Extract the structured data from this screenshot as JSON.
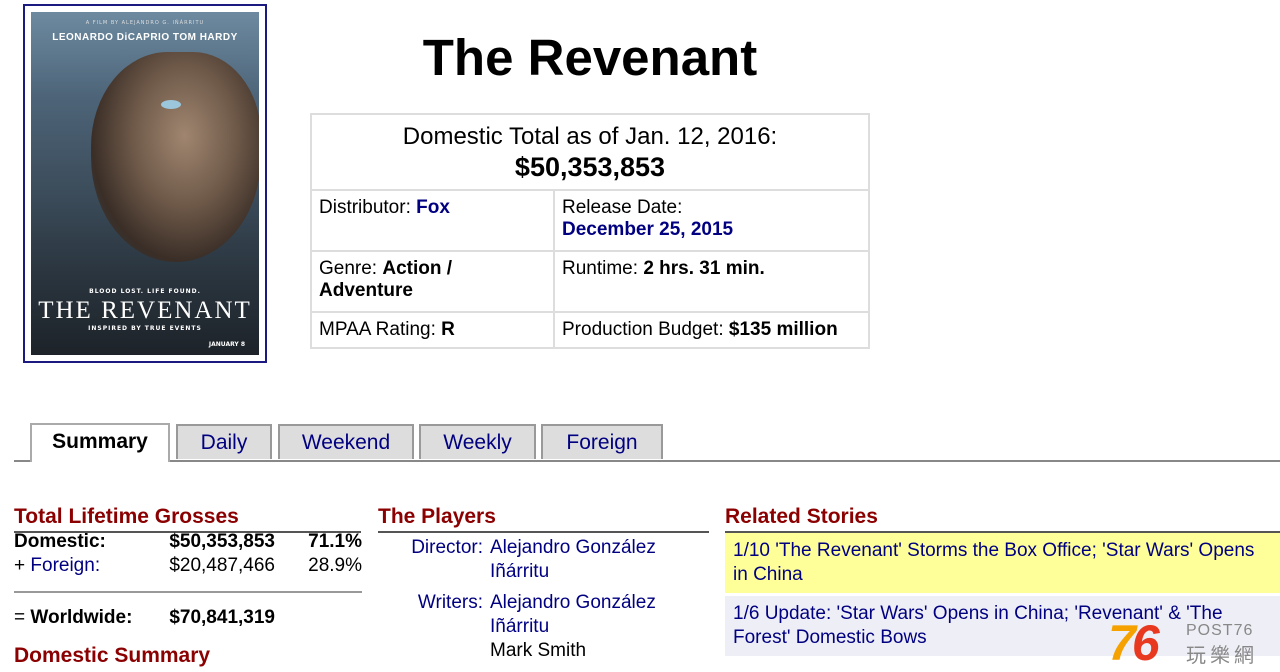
{
  "poster": {
    "small_credit": "A FILM BY ALEJANDRO G. IÑÁRRITU",
    "actors": "LEONARDO DiCAPRIO   TOM HARDY",
    "tagline": "BLOOD LOST. LIFE FOUND.",
    "title": "THE REVENANT",
    "subtitle": "INSPIRED BY TRUE EVENTS",
    "date": "JANUARY 8"
  },
  "movie": {
    "title": "The Revenant",
    "total_label": "Domestic Total as of Jan. 12, 2016:",
    "total_value": "$50,353,853",
    "distributor_label": "Distributor:",
    "distributor": "Fox",
    "release_label": "Release Date:",
    "release_date": "December 25, 2015",
    "genre_label": "Genre:",
    "genre": "Action / Adventure",
    "runtime_label": "Runtime:",
    "runtime": "2 hrs. 31 min.",
    "mpaa_label": "MPAA Rating:",
    "mpaa": "R",
    "budget_label": "Production Budget:",
    "budget": "$135 million"
  },
  "tabs": [
    {
      "label": "Summary"
    },
    {
      "label": "Daily"
    },
    {
      "label": "Weekend"
    },
    {
      "label": "Weekly"
    },
    {
      "label": "Foreign"
    }
  ],
  "grosses": {
    "heading": "Total Lifetime Grosses",
    "domestic_label": "Domestic:",
    "domestic_value": "$50,353,853",
    "domestic_pct": "71.1%",
    "foreign_prefix": "+",
    "foreign_label": "Foreign:",
    "foreign_value": "$20,487,466",
    "foreign_pct": "28.9%",
    "worldwide_prefix": "=",
    "worldwide_label": "Worldwide:",
    "worldwide_value": "$70,841,319",
    "domestic_summary_heading": "Domestic Summary"
  },
  "players": {
    "heading": "The Players",
    "director_label": "Director:",
    "director": "Alejandro González Iñárritu",
    "writers_label": "Writers:",
    "writer1": "Alejandro González Iñárritu",
    "writer2": "Mark Smith"
  },
  "stories": {
    "heading": "Related Stories",
    "items": [
      {
        "text": "1/10 'The Revenant' Storms the Box Office; 'Star Wars' Opens in China"
      },
      {
        "text": "1/6 Update: 'Star Wars' Opens in China; 'Revenant' & 'The Forest' Domestic Bows"
      }
    ]
  },
  "watermark": {
    "number_a": "7",
    "number_b": "6",
    "brand": "POST76",
    "cn": "玩樂網"
  }
}
